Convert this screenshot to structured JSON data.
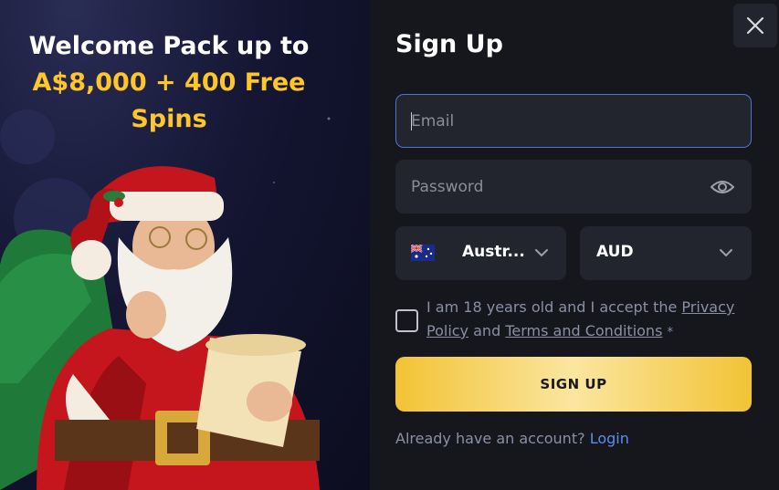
{
  "promo": {
    "title_line1": "Welcome Pack up to",
    "title_line2": "A$8,000 + 400 Free Spins",
    "title_line2_color": "#ffc629",
    "illustration": "santa-with-scroll"
  },
  "modal": {
    "close_icon": "close-icon",
    "title": "Sign Up"
  },
  "form": {
    "email": {
      "placeholder": "Email",
      "value": ""
    },
    "password": {
      "placeholder": "Password",
      "value": "",
      "toggle_icon": "eye-icon"
    },
    "country": {
      "value": "Austr...",
      "flag_icon": "australia-flag-icon"
    },
    "currency": {
      "value": "AUD"
    },
    "terms": {
      "prefix": "I am 18 years old and I accept the",
      "privacy_link": "Privacy Policy",
      "and": "and",
      "terms_link": "Terms and Conditions",
      "required_mark": "*",
      "checked": false
    },
    "submit_label": "SIGN UP",
    "login_prompt": "Already have an account?",
    "login_link": "Login"
  },
  "colors": {
    "accent_focus": "#4f72d8",
    "button_gold": "#f2c335",
    "link_blue": "#5b8cf2",
    "panel_bg": "#16171c",
    "field_bg": "#23252e"
  }
}
